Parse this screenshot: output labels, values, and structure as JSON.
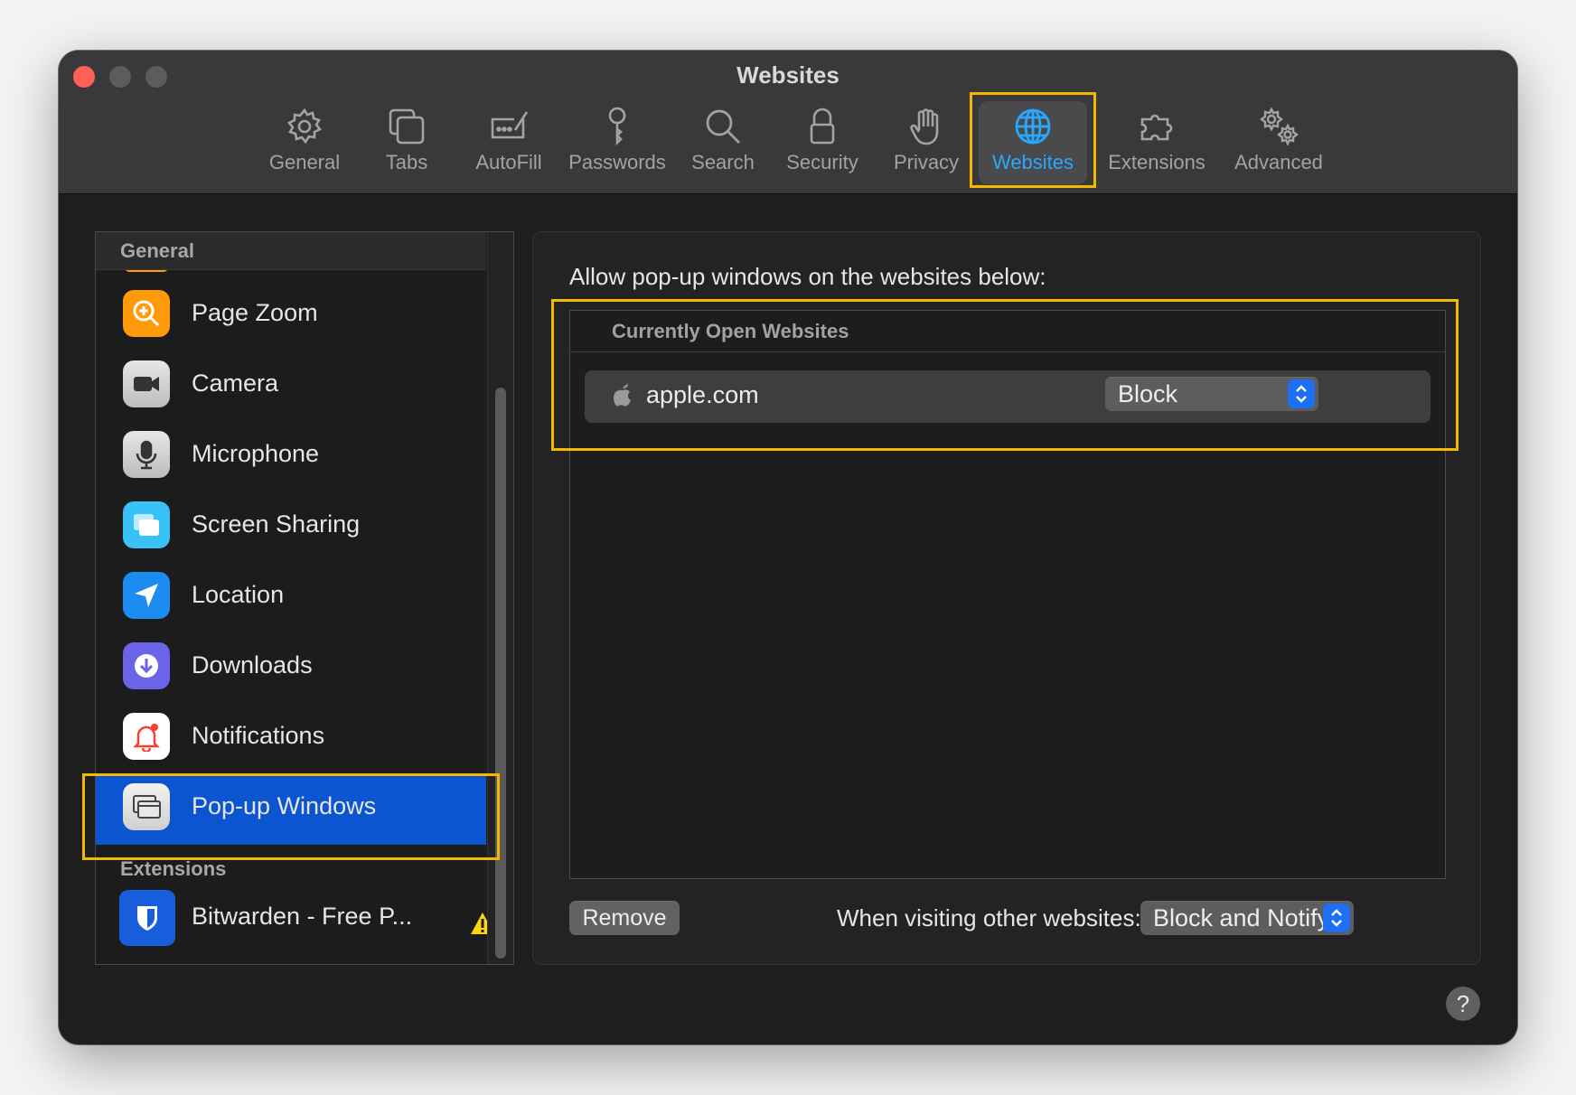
{
  "window": {
    "title": "Websites"
  },
  "toolbar": {
    "tabs": [
      {
        "label": "General",
        "icon": "gear-icon"
      },
      {
        "label": "Tabs",
        "icon": "tabs-icon"
      },
      {
        "label": "AutoFill",
        "icon": "autofill-icon"
      },
      {
        "label": "Passwords",
        "icon": "key-icon"
      },
      {
        "label": "Search",
        "icon": "search-icon"
      },
      {
        "label": "Security",
        "icon": "lock-icon"
      },
      {
        "label": "Privacy",
        "icon": "hand-icon"
      },
      {
        "label": "Websites",
        "icon": "globe-icon",
        "active": true
      },
      {
        "label": "Extensions",
        "icon": "puzzle-icon"
      },
      {
        "label": "Advanced",
        "icon": "gears-icon"
      }
    ]
  },
  "sidebar": {
    "general_header": "General",
    "items": [
      {
        "label": "Page Zoom",
        "icon": "page-zoom-icon",
        "color": "#ff9a0a"
      },
      {
        "label": "Camera",
        "icon": "camera-icon",
        "color": "#d9d9d9"
      },
      {
        "label": "Microphone",
        "icon": "microphone-icon",
        "color": "#d9d9d9"
      },
      {
        "label": "Screen Sharing",
        "icon": "screen-sharing-icon",
        "color": "#38c2f5"
      },
      {
        "label": "Location",
        "icon": "location-icon",
        "color": "#1d8cf0"
      },
      {
        "label": "Downloads",
        "icon": "downloads-icon",
        "color": "#6b63e8"
      },
      {
        "label": "Notifications",
        "icon": "notifications-icon",
        "color": "#ffffff"
      },
      {
        "label": "Pop-up Windows",
        "icon": "popup-windows-icon",
        "color": "#e0e0e0",
        "selected": true
      }
    ],
    "extensions_header": "Extensions",
    "extensions": [
      {
        "label": "Bitwarden - Free P...",
        "icon": "bitwarden-shield-icon",
        "color": "#175ddc",
        "warning": true
      }
    ]
  },
  "panel": {
    "caption": "Allow pop-up windows on the websites below:",
    "list_header": "Currently Open Websites",
    "sites": [
      {
        "name": "apple.com",
        "setting": "Block"
      }
    ],
    "remove_button": "Remove",
    "other_label": "When visiting other websites:",
    "other_setting": "Block and Notify"
  },
  "help_button": "?",
  "colors": {
    "accent": "#29a8ff",
    "selection": "#0b56d0",
    "highlight_box": "#f5b700"
  }
}
